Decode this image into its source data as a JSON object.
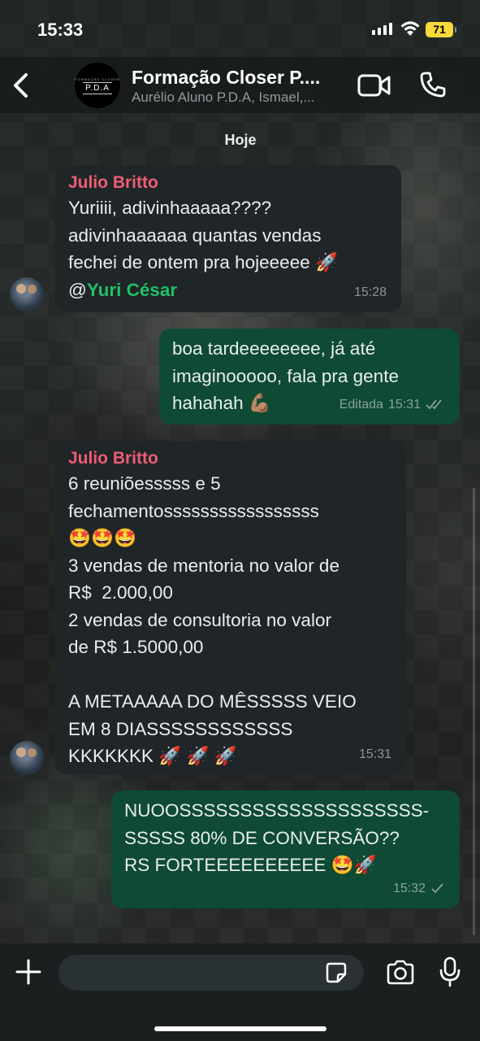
{
  "status_bar": {
    "time": "15:33",
    "battery": "71"
  },
  "header": {
    "title": "Formação Closer P....",
    "subtitle": "Aurélio Aluno P.D.A, Ismael,...",
    "avatar_small_text": "FORMAÇÃO CLOSER",
    "avatar_logo": "P.D.A"
  },
  "date_label": "Hoje",
  "messages": [
    {
      "sender": "Julio Britto",
      "text": "Yuriiii, adivinhaaaaa????\nadivinhaaaaaa quantas vendas\nfechei de ontem pra hojeeeee 🚀",
      "mention_prefix": "@",
      "mention": "Yuri César",
      "time": "15:28"
    },
    {
      "text": "boa tardeeeeeeee, já até\nimaginooooo, fala pra gente\nhahahah 💪🏽",
      "edited": "Editada",
      "time": "15:31",
      "status": "read"
    },
    {
      "sender": "Julio Britto",
      "text": "6 reuniõesssss e 5\nfechamentosssssssssssssssss\n🤩🤩🤩\n3 vendas de mentoria no valor de\nR$  2.000,00\n2 vendas de consultoria no valor\nde R$ 1.5000,00\n\nA METAAAAA DO MÊSSSSS VEIO\nEM 8 DIASSSSSSSSSSSS\nKKKKKKK 🚀 🚀 🚀",
      "time": "15:31"
    },
    {
      "text": "NUOOSSSSSSSSSSSSSSSSSSSS-\nSSSSS 80% DE CONVERSÃO??\nRS FORTEEEEEEEEEE 🤩🚀",
      "time": "15:32",
      "status": "sent"
    }
  ],
  "input": {
    "placeholder": ""
  },
  "colors": {
    "outgoing": "#0e4a34",
    "incoming": "#202628",
    "sender": "#ee5c74",
    "mention": "#21c063"
  },
  "icons": [
    "back-icon",
    "video-call-icon",
    "phone-icon",
    "plus-icon",
    "sticker-icon",
    "camera-icon",
    "mic-icon",
    "read-ticks-icon",
    "sent-tick-icon"
  ]
}
